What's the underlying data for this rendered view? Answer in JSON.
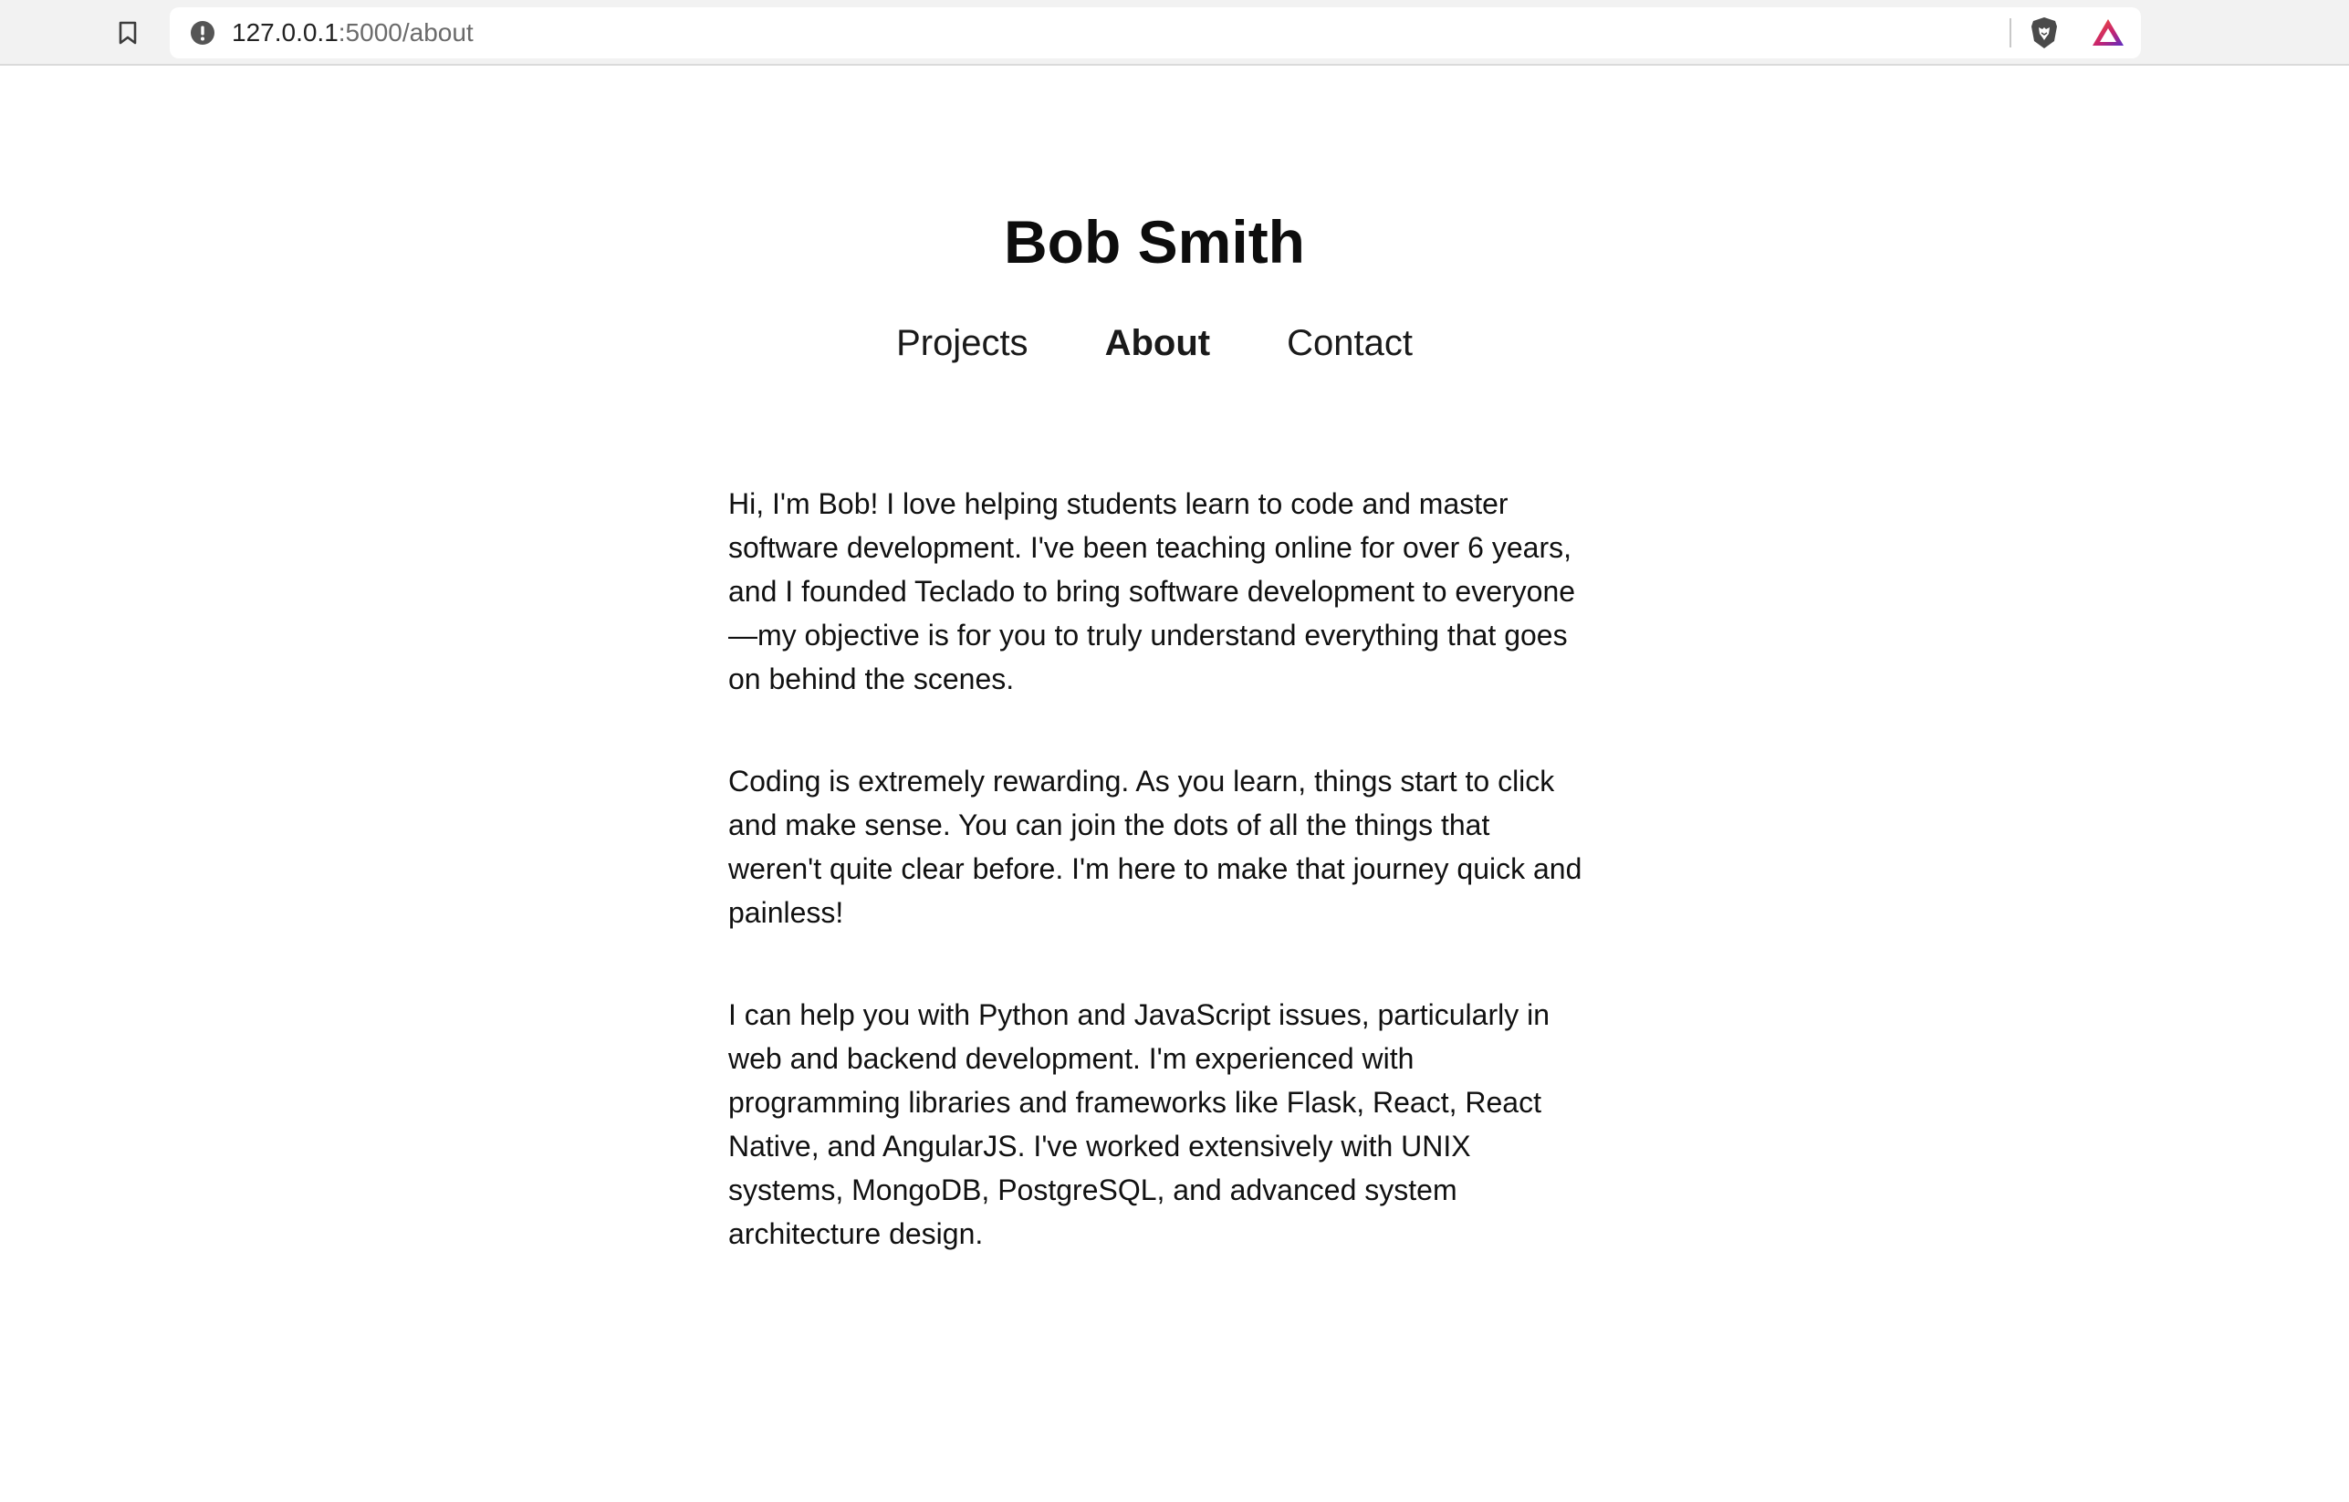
{
  "browser": {
    "url_host": "127.0.0.1",
    "url_path": ":5000/about",
    "icons": {
      "bookmark": "bookmark-icon",
      "site_info": "info-icon",
      "shields": "brave-shields-icon",
      "rewards": "brave-rewards-icon"
    }
  },
  "site": {
    "title": "Bob Smith"
  },
  "nav": {
    "items": [
      {
        "label": "Projects",
        "active": false
      },
      {
        "label": "About",
        "active": true
      },
      {
        "label": "Contact",
        "active": false
      }
    ]
  },
  "about": {
    "paragraphs": [
      "Hi, I'm Bob! I love helping students learn to code and master software development. I've been teaching online for over 6 years, and I founded Teclado to bring software development to everyone—my objective is for you to truly understand everything that goes on behind the scenes.",
      "Coding is extremely rewarding. As you learn, things start to click and make sense. You can join the dots of all the things that weren't quite clear before. I'm here to make that journey quick and painless!",
      "I can help you with Python and JavaScript issues, particularly in web and backend development. I'm experienced with programming libraries and frameworks like Flask, React, React Native, and AngularJS. I've worked extensively with UNIX systems, MongoDB, PostgreSQL, and advanced system architecture design."
    ]
  },
  "colors": {
    "toolbar_bg": "#f2f2f2",
    "text": "#111111",
    "url_path": "#6b6b6b"
  }
}
